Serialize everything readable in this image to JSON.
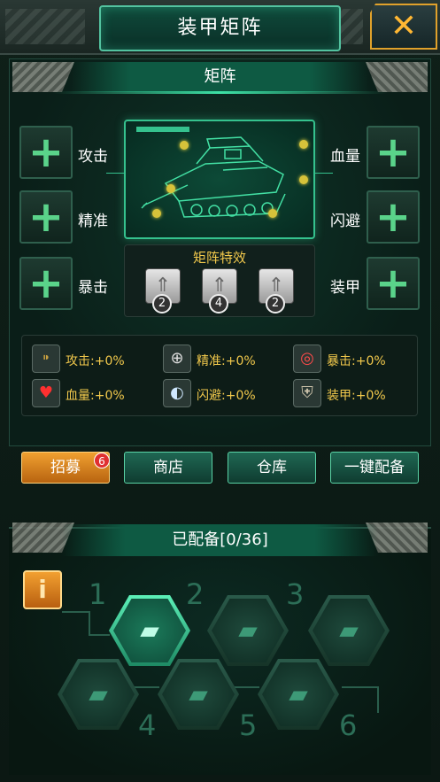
{
  "header": {
    "title": "装甲矩阵",
    "close_symbol": "✕"
  },
  "matrix": {
    "section_title": "矩阵",
    "slots_left": [
      {
        "label": "攻击",
        "symbol": "+"
      },
      {
        "label": "精准",
        "symbol": "+"
      },
      {
        "label": "暴击",
        "symbol": "+"
      }
    ],
    "slots_right": [
      {
        "label": "血量",
        "symbol": "+"
      },
      {
        "label": "闪避",
        "symbol": "+"
      },
      {
        "label": "装甲",
        "symbol": "+"
      }
    ],
    "effect": {
      "title": "矩阵特效",
      "chips": [
        {
          "count": "2"
        },
        {
          "count": "4"
        },
        {
          "count": "2"
        }
      ]
    }
  },
  "stats": [
    {
      "icon": "bullet-icon",
      "symbol": "⁍",
      "label": "攻击:+0%"
    },
    {
      "icon": "crosshair-icon",
      "symbol": "⊕",
      "label": "精准:+0%"
    },
    {
      "icon": "target-icon",
      "symbol": "◎",
      "label": "暴击:+0%"
    },
    {
      "icon": "heart-icon",
      "symbol": "♥",
      "label": "血量:+0%"
    },
    {
      "icon": "dodge-icon",
      "symbol": "◐",
      "label": "闪避:+0%"
    },
    {
      "icon": "armor-icon",
      "symbol": "⛨",
      "label": "装甲:+0%"
    }
  ],
  "buttons": {
    "recruit": "招募",
    "recruit_badge": "6",
    "shop": "商店",
    "warehouse": "仓库",
    "auto_equip": "一键配备"
  },
  "equipped": {
    "title": "已配备[0/36]",
    "info_symbol": "i",
    "slots": [
      {
        "number": "1",
        "tank_glyph": "▰",
        "active": true
      },
      {
        "number": "2",
        "tank_glyph": "▰",
        "active": false
      },
      {
        "number": "3",
        "tank_glyph": "▰",
        "active": false
      },
      {
        "number": "4",
        "tank_glyph": "▰",
        "active": false
      },
      {
        "number": "5",
        "tank_glyph": "▰",
        "active": false
      },
      {
        "number": "6",
        "tank_glyph": "▰",
        "active": false
      }
    ]
  },
  "colors": {
    "accent": "#35c28e",
    "gold": "#f2c94c",
    "orange": "#f0a030"
  }
}
